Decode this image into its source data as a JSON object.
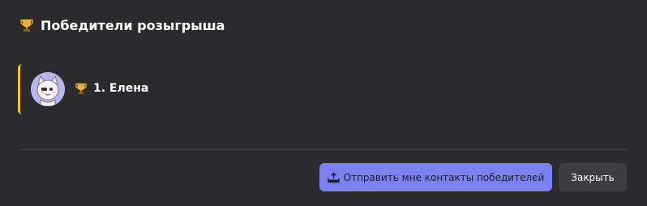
{
  "dialog": {
    "title": "Победители розыгрыша",
    "title_icon": "trophy-icon"
  },
  "winners": [
    {
      "rank_label": "1. Елена",
      "icon": "trophy-icon",
      "avatar": "anime-cat-avatar"
    }
  ],
  "footer": {
    "send_contacts_label": "Отправить мне контакты победителей",
    "send_icon": "upload-icon",
    "close_label": "Закрыть"
  },
  "colors": {
    "background": "#2b2b2e",
    "accent_bar": "#f2c230",
    "primary_button": "#7b81ee",
    "secondary_button": "#3d3d42"
  }
}
